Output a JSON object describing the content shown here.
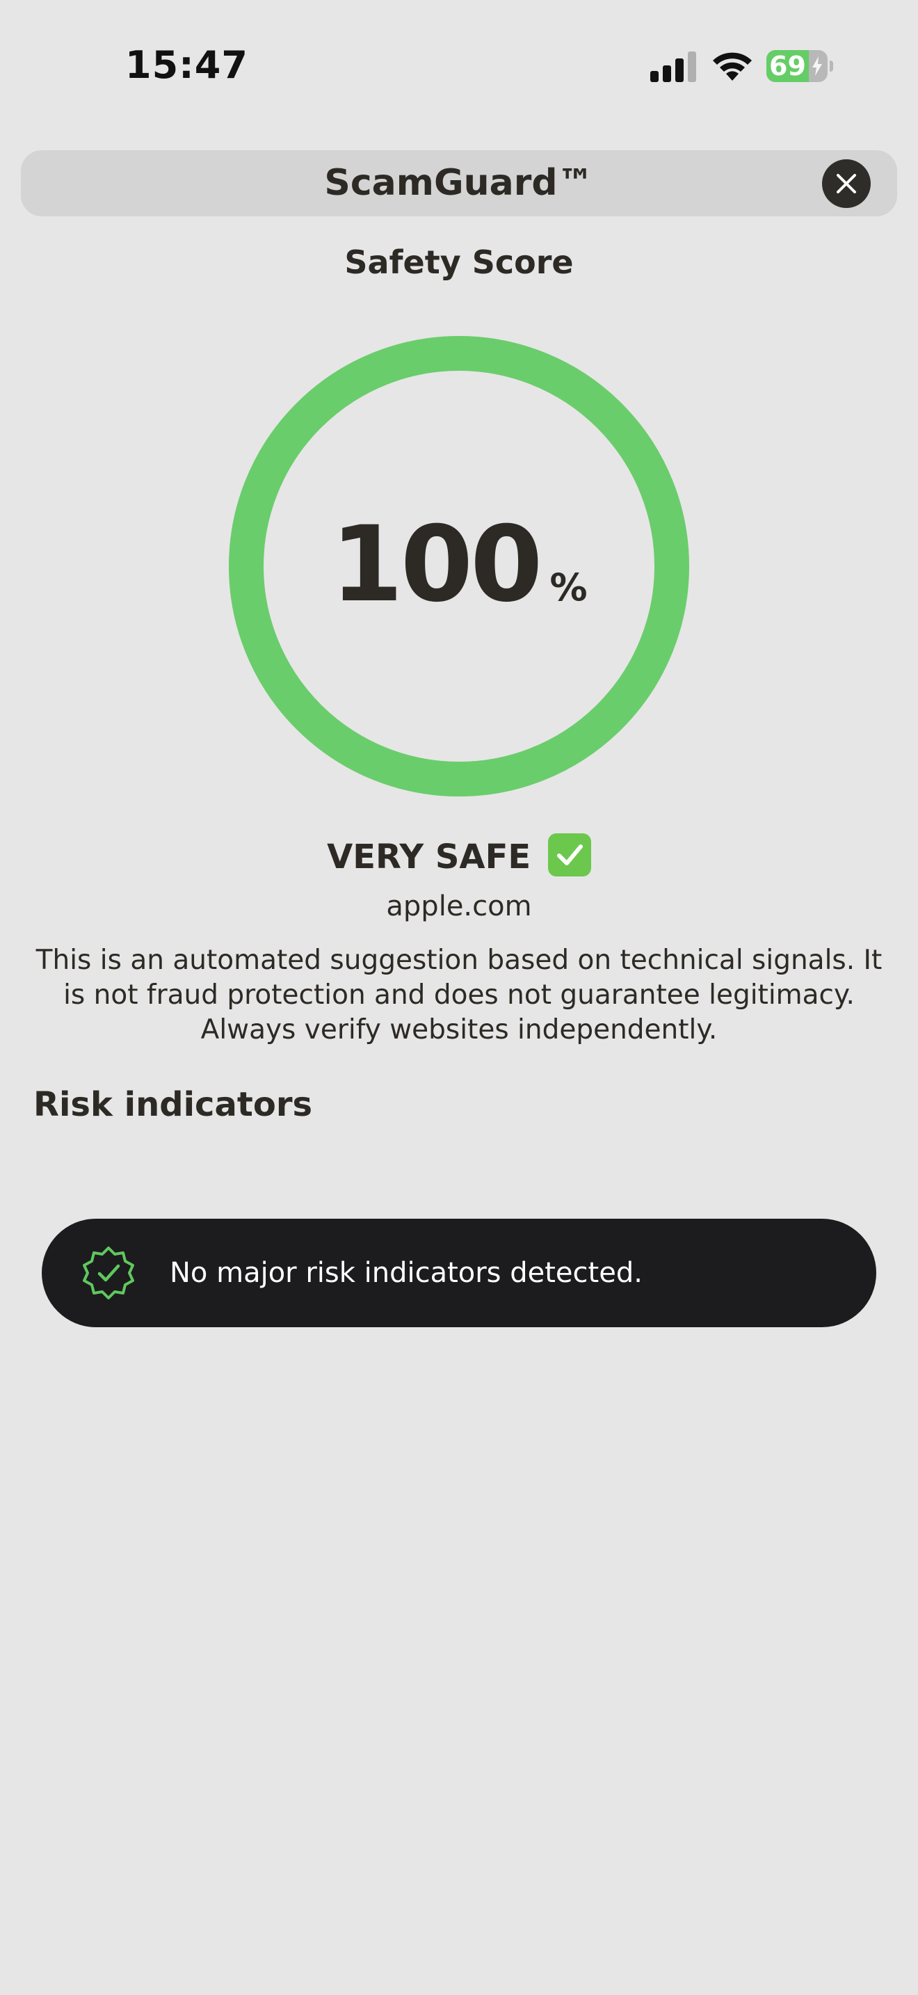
{
  "status_bar": {
    "time": "15:47",
    "battery_level": "69",
    "battery_fraction": 0.69,
    "battery_charging": true,
    "signal_bars_filled": 3,
    "signal_bars_total": 4,
    "icons": [
      "signal-icon",
      "wifi-icon",
      "battery-icon",
      "bolt-icon"
    ]
  },
  "header": {
    "title": "ScamGuard™",
    "close_icon": "close-icon"
  },
  "score": {
    "section_title": "Safety Score",
    "value": "100",
    "unit": "%",
    "fraction": 1.0,
    "ring_color": "#6acd6b"
  },
  "verdict": {
    "label": "VERY SAFE",
    "icon": "check-box-icon",
    "icon_color": "#6bc84d"
  },
  "domain": "apple.com",
  "disclaimer": "This is an automated suggestion based on technical signals. It is not fraud protection and does not guarantee legitimacy. Always verify websites independently.",
  "risk": {
    "heading": "Risk indicators",
    "items": [
      {
        "icon": "verified-badge-icon",
        "text": "No major risk indicators detected."
      }
    ]
  },
  "colors": {
    "background": "#e6e6e6",
    "accent_green": "#6acd6b",
    "card_dark": "#1c1c1e",
    "text_dark": "#2d2a25"
  }
}
